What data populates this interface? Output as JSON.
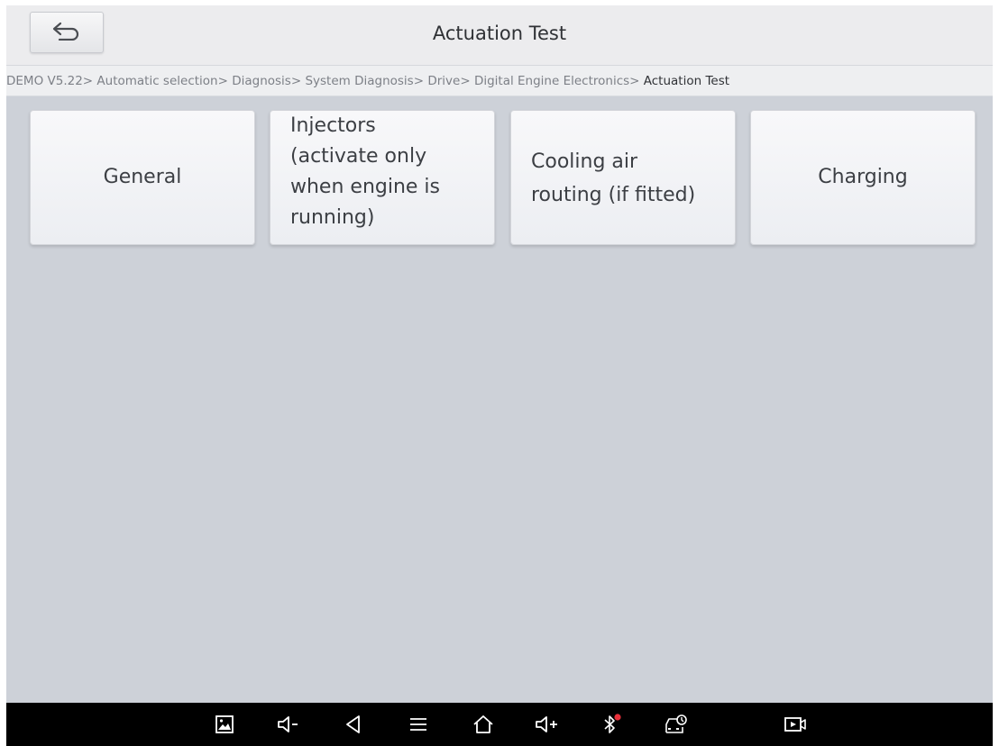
{
  "header": {
    "title": "Actuation Test",
    "back_icon": "back-arrow-icon"
  },
  "breadcrumb": [
    {
      "label": "DEMO V5.22"
    },
    {
      "label": "Automatic selection"
    },
    {
      "label": "Diagnosis"
    },
    {
      "label": "System Diagnosis"
    },
    {
      "label": "Drive"
    },
    {
      "label": "Digital Engine Electronics"
    },
    {
      "label": "Actuation Test"
    }
  ],
  "breadcrumb_separator": ">",
  "tiles": [
    {
      "label": "General"
    },
    {
      "lines": [
        "Injectors",
        "(activate only",
        "when engine is",
        "running)"
      ]
    },
    {
      "lines": [
        "Cooling air",
        "routing (if fitted)"
      ]
    },
    {
      "label": "Charging"
    }
  ],
  "navbar": {
    "icons": [
      "screenshot-icon",
      "volume-down-icon",
      "back-icon",
      "menu-icon",
      "home-icon",
      "volume-up-icon",
      "bluetooth-icon",
      "vci-icon",
      "screen-record-icon"
    ]
  },
  "colors": {
    "content_background": "#cdd1d8",
    "titlebar_background": "#ececee",
    "navbar_background": "#000000",
    "bluetooth_alert": "#e8303a"
  }
}
